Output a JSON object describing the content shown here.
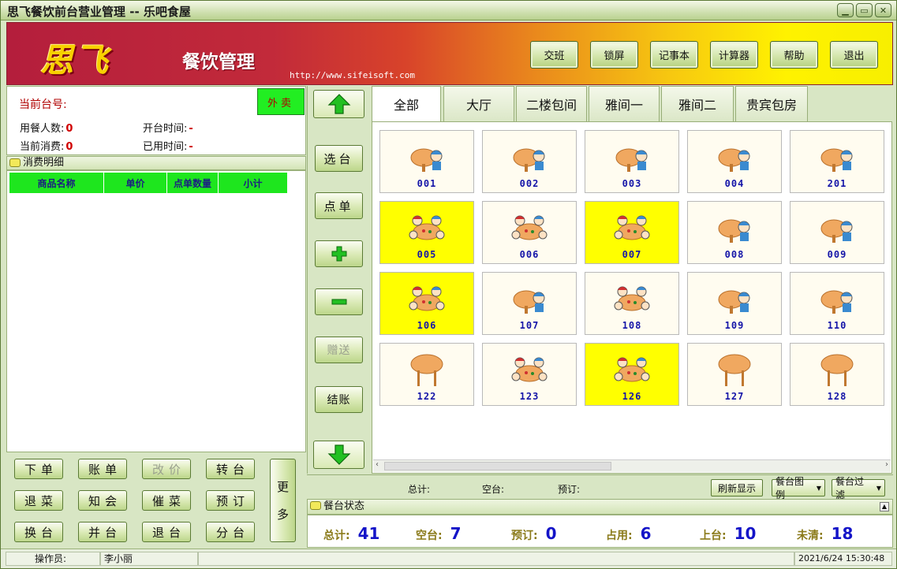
{
  "window": {
    "title": "思飞餐饮前台营业管理 -- 乐吧食屋",
    "controls": [
      "▁",
      "▭",
      "✕"
    ]
  },
  "banner": {
    "logo": "思飞",
    "subtitle": "餐饮管理",
    "url": "http://www.sifeisoft.com",
    "buttons": [
      "交班",
      "锁屏",
      "记事本",
      "计算器",
      "帮助",
      "退出"
    ]
  },
  "current": {
    "table_label": "当前台号:",
    "takeout_label": "外卖",
    "diners_label": "用餐人数:",
    "diners_value": "0",
    "spend_label": "当前消费:",
    "spend_value": "0",
    "open_time_label": "开台时间:",
    "open_time_value": "-",
    "used_time_label": "已用时间:",
    "used_time_value": "-"
  },
  "detail": {
    "header": "消费明细",
    "columns": [
      "商品名称",
      "单价",
      "点单数量",
      "小计"
    ]
  },
  "ops": {
    "buttons": [
      {
        "label": "下单",
        "enabled": true
      },
      {
        "label": "账单",
        "enabled": true
      },
      {
        "label": "改价",
        "enabled": false
      },
      {
        "label": "转台",
        "enabled": true
      },
      {
        "label": "退菜",
        "enabled": true
      },
      {
        "label": "知会",
        "enabled": true
      },
      {
        "label": "催菜",
        "enabled": true
      },
      {
        "label": "预订",
        "enabled": true
      },
      {
        "label": "换台",
        "enabled": true
      },
      {
        "label": "并台",
        "enabled": true
      },
      {
        "label": "退台",
        "enabled": true
      },
      {
        "label": "分台",
        "enabled": true
      }
    ],
    "more_label": [
      "更",
      "多"
    ]
  },
  "middle": {
    "select_table": "选台",
    "order": "点单",
    "plus": "+",
    "minus": "−",
    "gift": "赠送",
    "checkout": "结账"
  },
  "tabs": [
    "全部",
    "大厅",
    "二楼包间",
    "雅间一",
    "雅间二",
    "贵宾包房"
  ],
  "active_tab": "全部",
  "tables": [
    {
      "num": "001",
      "state": "free"
    },
    {
      "num": "002",
      "state": "free"
    },
    {
      "num": "003",
      "state": "free"
    },
    {
      "num": "004",
      "state": "free"
    },
    {
      "num": "201",
      "state": "free"
    },
    {
      "num": "005",
      "state": "occupied"
    },
    {
      "num": "006",
      "state": "reserved"
    },
    {
      "num": "007",
      "state": "occupied"
    },
    {
      "num": "008",
      "state": "free"
    },
    {
      "num": "009",
      "state": "free"
    },
    {
      "num": "106",
      "state": "occupied"
    },
    {
      "num": "107",
      "state": "free"
    },
    {
      "num": "108",
      "state": "reserved"
    },
    {
      "num": "109",
      "state": "free"
    },
    {
      "num": "110",
      "state": "free"
    },
    {
      "num": "122",
      "state": "empty"
    },
    {
      "num": "123",
      "state": "reserved"
    },
    {
      "num": "126",
      "state": "occupied"
    },
    {
      "num": "127",
      "state": "empty"
    },
    {
      "num": "128",
      "state": "empty"
    }
  ],
  "summary": {
    "total_label": "总计:",
    "vacant_label": "空台:",
    "reserved_label": "预订:",
    "refresh_btn": "刷新显示",
    "legend_btn": "餐台图例",
    "filter_btn": "餐台过滤"
  },
  "state": {
    "header": "餐台状态",
    "items": [
      {
        "label": "总计:",
        "value": "41"
      },
      {
        "label": "空台:",
        "value": "7"
      },
      {
        "label": "预订:",
        "value": "0"
      },
      {
        "label": "占用:",
        "value": "6"
      },
      {
        "label": "上台:",
        "value": "10"
      },
      {
        "label": "未清:",
        "value": "18"
      }
    ]
  },
  "statusbar": {
    "operator_label": "操作员:",
    "operator": "李小丽",
    "datetime": "2021/6/24 15:30:48"
  },
  "colors": {
    "occupied": "#ffff00",
    "free": "#fffcf0",
    "table_number": "#1414a8",
    "header_green": "#1ee61e"
  }
}
